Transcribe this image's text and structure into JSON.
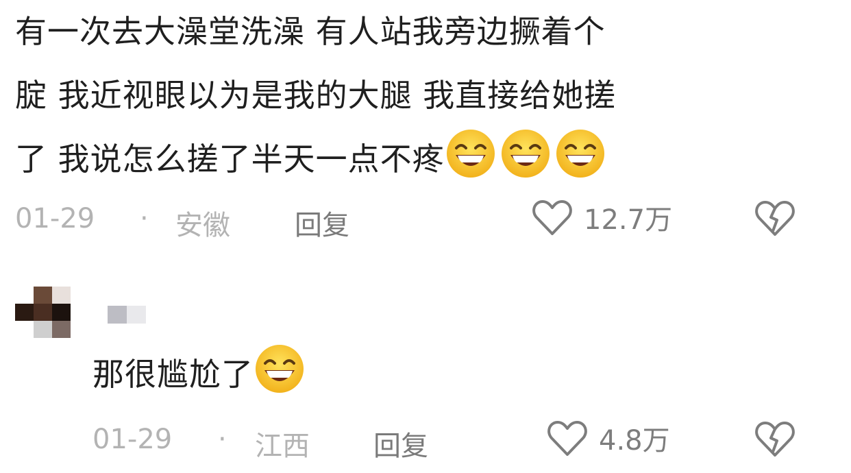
{
  "comments": [
    {
      "lines": [
        "有一次去大澡堂洗澡 有人站我旁边撅着个",
        "腚 我近视眼以为是我的大腿 我直接给她搓",
        "了 我说怎么搓了半天一点不疼"
      ],
      "emojis": [
        "grin-emoji",
        "grin-emoji",
        "grin-emoji"
      ],
      "date": "01-29",
      "separator": "·",
      "location": "安徽",
      "reply_label": "回复",
      "likes": "12.7万"
    },
    {
      "text": "那很尴尬了",
      "emojis": [
        "grin-emoji"
      ],
      "date": "01-29",
      "separator": "·",
      "location": "江西",
      "reply_label": "回复",
      "likes": "4.8万"
    }
  ],
  "icons": {
    "like": "heart-outline-icon",
    "dislike": "broken-heart-icon"
  },
  "colors": {
    "text": "#1f1f1f",
    "meta": "#b3b3b3",
    "reply": "#7a7a7a",
    "emoji_face": "#f7c531"
  }
}
